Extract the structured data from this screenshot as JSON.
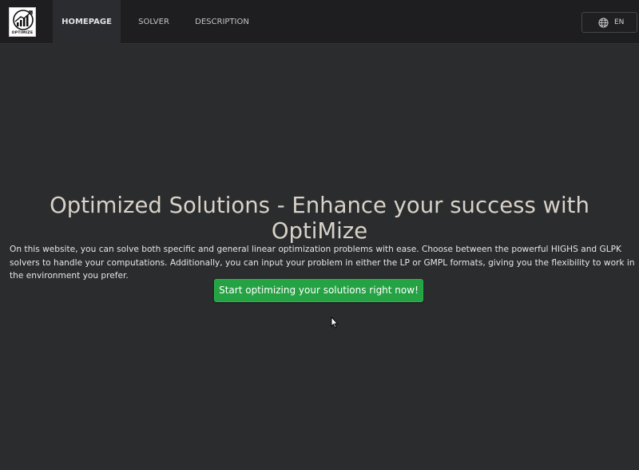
{
  "navbar": {
    "logo_text": "OPTIMIZE",
    "items": [
      {
        "label": "HOMEPAGE",
        "active": true
      },
      {
        "label": "SOLVER",
        "active": false
      },
      {
        "label": "DESCRIPTION",
        "active": false
      }
    ],
    "language": {
      "icon": "globe-icon",
      "label": "EN"
    }
  },
  "hero": {
    "title": "Optimized Solutions - Enhance your success with OptiMize",
    "description": "On this website, you can solve both specific and general linear optimization problems with ease. Choose between the powerful HIGHS and GLPK solvers to handle your computations. Additionally, you can input your problem in either the LP or GMPL formats, giving you the flexibility to work in the environment you prefer.",
    "cta_label": "Start optimizing your solutions right now!"
  },
  "colors": {
    "background": "#2b2c2e",
    "navbar": "#1e1e21",
    "accent_green": "#25a244",
    "title_text": "#d8d2c8"
  }
}
